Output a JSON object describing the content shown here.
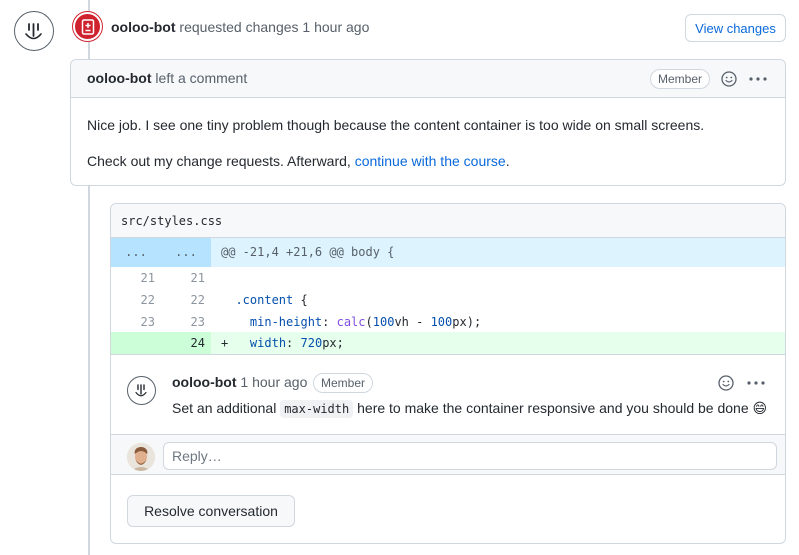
{
  "review": {
    "author": "ooloo-bot",
    "action": "requested changes",
    "time": "1 hour ago",
    "view_changes_label": "View changes"
  },
  "comment": {
    "author": "ooloo-bot",
    "action": "left a comment",
    "role": "Member",
    "paragraph1": "Nice job. I see one tiny problem though because the content container is too wide on small screens.",
    "paragraph2_prefix": "Check out my change requests. Afterward, ",
    "paragraph2_link": "continue with the course",
    "paragraph2_suffix": "."
  },
  "diff": {
    "filename": "src/styles.css",
    "hunk": {
      "old_num": "...",
      "new_num": "...",
      "header": "@@ -21,4 +21,6 @@ body {"
    },
    "lines": [
      {
        "old": "21",
        "new": "21",
        "text": ""
      },
      {
        "old": "22",
        "new": "22",
        "selector": ".content",
        "brace": " {"
      },
      {
        "old": "23",
        "new": "23",
        "prop": "min-height",
        "fn": "calc",
        "num1": "100",
        "unit1": "vh",
        "op": " - ",
        "num2": "100",
        "unit2": "px"
      },
      {
        "old": "",
        "new": "24",
        "marker": "+",
        "prop": "width",
        "num": "720",
        "unit": "px"
      }
    ]
  },
  "inline_comment": {
    "author": "ooloo-bot",
    "time": "1 hour ago",
    "role": "Member",
    "body_prefix": "Set an additional ",
    "body_code": "max-width",
    "body_suffix": " here to make the container responsive and you should be done 😄"
  },
  "reply": {
    "placeholder": "Reply…"
  },
  "resolve_label": "Resolve conversation",
  "colors": {
    "accent": "#0969da",
    "danger": "#cf222e",
    "added_bg": "#e6ffec",
    "hunk_bg": "#ddf4ff"
  }
}
